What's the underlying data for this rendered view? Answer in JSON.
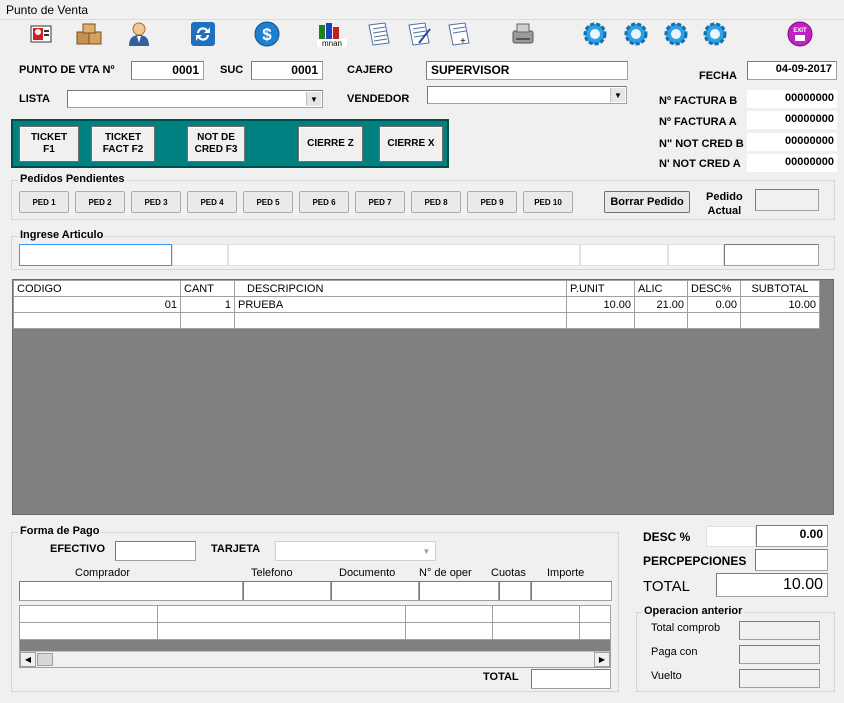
{
  "window": {
    "title": "Punto de Venta"
  },
  "toolbar": {
    "buttons": [
      {
        "name": "cliente-card-icon",
        "color": "#d02020"
      },
      {
        "name": "boxes-icon",
        "color": "#c89050"
      },
      {
        "name": "user-icon",
        "color": "#3060a0"
      },
      {
        "name": "refresh-icon",
        "color": "#2070c0"
      },
      {
        "name": "dollar-icon",
        "color": "#2080d0"
      },
      {
        "name": "chart-icon",
        "color": "#208020"
      },
      {
        "name": "document-icon",
        "color": "#5070a0"
      },
      {
        "name": "document-edit-icon",
        "color": "#5070a0"
      },
      {
        "name": "document-add-icon",
        "color": "#5070a0"
      },
      {
        "name": "printer-icon",
        "color": "#808080"
      },
      {
        "name": "gear-icon-1",
        "color": "#30a0e0"
      },
      {
        "name": "gear-icon-2",
        "color": "#30a0e0"
      },
      {
        "name": "gear-icon-3",
        "color": "#30a0e0"
      },
      {
        "name": "gear-icon-4",
        "color": "#30a0e0"
      },
      {
        "name": "exit-icon",
        "color": "#c020c0"
      }
    ],
    "chart_label": "mnan",
    "exit_label": "EXIT"
  },
  "header": {
    "punto_label": "PUNTO DE VTA Nº",
    "punto_value": "0001",
    "suc_label": "SUC",
    "suc_value": "0001",
    "cajero_label": "CAJERO",
    "cajero_value": "SUPERVISOR",
    "lista_label": "LISTA",
    "lista_value": "",
    "vendedor_label": "VENDEDOR",
    "vendedor_value": "",
    "fecha_label": "FECHA",
    "fecha_value": "04-09-2017"
  },
  "comprobantes": [
    {
      "label": "Nº FACTURA B",
      "value": "00000000"
    },
    {
      "label": "Nº FACTURA A",
      "value": "00000000"
    },
    {
      "label": "N\" NOT CRED B",
      "value": "00000000"
    },
    {
      "label": "N' NOT CRED A",
      "value": "00000000"
    }
  ],
  "teal_buttons": [
    {
      "label": "TICKET\n        F1"
    },
    {
      "label": "TICKET\nFACT    F2"
    },
    {
      "label": "NOT DE\nCRED F3"
    },
    {
      "label": "CIERRE Z"
    },
    {
      "label": "CIERRE X"
    }
  ],
  "pedidos": {
    "title": "Pedidos Pendientes",
    "buttons": [
      "PED 1",
      "PED 2",
      "PED 3",
      "PED 4",
      "PED 5",
      "PED 6",
      "PED 7",
      "PED 8",
      "PED 9",
      "PED 10"
    ],
    "borrar_label": "Borrar Pedido",
    "actual_label": "Pedido\nActual",
    "actual_value": ""
  },
  "articulo": {
    "title": "Ingrese Articulo",
    "value": ""
  },
  "grid": {
    "columns": [
      "CODIGO",
      "CANT",
      "DESCRIPCION",
      "P.UNIT",
      "ALIC",
      "DESC%",
      "SUBTOTAL"
    ],
    "rows": [
      [
        "01",
        "1",
        "PRUEBA",
        "10.00",
        "21.00",
        "0.00",
        "10.00"
      ],
      [
        "",
        "",
        "",
        "",
        "",
        "",
        ""
      ]
    ]
  },
  "pago": {
    "title": "Forma de Pago",
    "efectivo_label": "EFECTIVO",
    "efectivo_value": "",
    "tarjeta_label": "TARJETA",
    "tarjeta_value": "",
    "columns": [
      "Comprador",
      "Telefono",
      "Documento",
      "N° de oper",
      "Cuotas",
      "Importe"
    ],
    "total_label": "TOTAL",
    "total_value": ""
  },
  "totales": {
    "desc_label": "DESC %",
    "desc_pct": "",
    "desc_value": "0.00",
    "percep_label": "PERCPEPCIONES",
    "percep_value": "",
    "total_label": "TOTAL",
    "total_value": "10.00"
  },
  "operacion": {
    "title": "Operacion anterior",
    "total_comprob_label": "Total comprob",
    "total_comprob_value": "",
    "paga_con_label": "Paga con",
    "paga_con_value": "",
    "vuelto_label": "Vuelto",
    "vuelto_value": ""
  }
}
